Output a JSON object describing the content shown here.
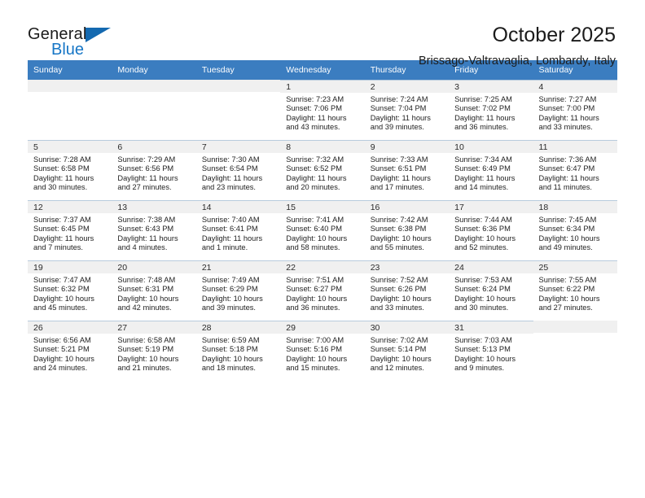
{
  "brand": {
    "name_part1": "General",
    "name_part2": "Blue",
    "triangle_color": "#1469b0",
    "blue_color": "#1676c6"
  },
  "header": {
    "title": "October 2025",
    "subtitle": "Brissago-Valtravaglia, Lombardy, Italy"
  },
  "calendar": {
    "header_bg": "#3b7dc0",
    "weekdays": [
      "Sunday",
      "Monday",
      "Tuesday",
      "Wednesday",
      "Thursday",
      "Friday",
      "Saturday"
    ],
    "weeks": [
      [
        {
          "day": "",
          "sunrise": "",
          "sunset": "",
          "daylight_line1": "",
          "daylight_line2": ""
        },
        {
          "day": "",
          "sunrise": "",
          "sunset": "",
          "daylight_line1": "",
          "daylight_line2": ""
        },
        {
          "day": "",
          "sunrise": "",
          "sunset": "",
          "daylight_line1": "",
          "daylight_line2": ""
        },
        {
          "day": "1",
          "sunrise": "Sunrise: 7:23 AM",
          "sunset": "Sunset: 7:06 PM",
          "daylight_line1": "Daylight: 11 hours",
          "daylight_line2": "and 43 minutes."
        },
        {
          "day": "2",
          "sunrise": "Sunrise: 7:24 AM",
          "sunset": "Sunset: 7:04 PM",
          "daylight_line1": "Daylight: 11 hours",
          "daylight_line2": "and 39 minutes."
        },
        {
          "day": "3",
          "sunrise": "Sunrise: 7:25 AM",
          "sunset": "Sunset: 7:02 PM",
          "daylight_line1": "Daylight: 11 hours",
          "daylight_line2": "and 36 minutes."
        },
        {
          "day": "4",
          "sunrise": "Sunrise: 7:27 AM",
          "sunset": "Sunset: 7:00 PM",
          "daylight_line1": "Daylight: 11 hours",
          "daylight_line2": "and 33 minutes."
        }
      ],
      [
        {
          "day": "5",
          "sunrise": "Sunrise: 7:28 AM",
          "sunset": "Sunset: 6:58 PM",
          "daylight_line1": "Daylight: 11 hours",
          "daylight_line2": "and 30 minutes."
        },
        {
          "day": "6",
          "sunrise": "Sunrise: 7:29 AM",
          "sunset": "Sunset: 6:56 PM",
          "daylight_line1": "Daylight: 11 hours",
          "daylight_line2": "and 27 minutes."
        },
        {
          "day": "7",
          "sunrise": "Sunrise: 7:30 AM",
          "sunset": "Sunset: 6:54 PM",
          "daylight_line1": "Daylight: 11 hours",
          "daylight_line2": "and 23 minutes."
        },
        {
          "day": "8",
          "sunrise": "Sunrise: 7:32 AM",
          "sunset": "Sunset: 6:52 PM",
          "daylight_line1": "Daylight: 11 hours",
          "daylight_line2": "and 20 minutes."
        },
        {
          "day": "9",
          "sunrise": "Sunrise: 7:33 AM",
          "sunset": "Sunset: 6:51 PM",
          "daylight_line1": "Daylight: 11 hours",
          "daylight_line2": "and 17 minutes."
        },
        {
          "day": "10",
          "sunrise": "Sunrise: 7:34 AM",
          "sunset": "Sunset: 6:49 PM",
          "daylight_line1": "Daylight: 11 hours",
          "daylight_line2": "and 14 minutes."
        },
        {
          "day": "11",
          "sunrise": "Sunrise: 7:36 AM",
          "sunset": "Sunset: 6:47 PM",
          "daylight_line1": "Daylight: 11 hours",
          "daylight_line2": "and 11 minutes."
        }
      ],
      [
        {
          "day": "12",
          "sunrise": "Sunrise: 7:37 AM",
          "sunset": "Sunset: 6:45 PM",
          "daylight_line1": "Daylight: 11 hours",
          "daylight_line2": "and 7 minutes."
        },
        {
          "day": "13",
          "sunrise": "Sunrise: 7:38 AM",
          "sunset": "Sunset: 6:43 PM",
          "daylight_line1": "Daylight: 11 hours",
          "daylight_line2": "and 4 minutes."
        },
        {
          "day": "14",
          "sunrise": "Sunrise: 7:40 AM",
          "sunset": "Sunset: 6:41 PM",
          "daylight_line1": "Daylight: 11 hours",
          "daylight_line2": "and 1 minute."
        },
        {
          "day": "15",
          "sunrise": "Sunrise: 7:41 AM",
          "sunset": "Sunset: 6:40 PM",
          "daylight_line1": "Daylight: 10 hours",
          "daylight_line2": "and 58 minutes."
        },
        {
          "day": "16",
          "sunrise": "Sunrise: 7:42 AM",
          "sunset": "Sunset: 6:38 PM",
          "daylight_line1": "Daylight: 10 hours",
          "daylight_line2": "and 55 minutes."
        },
        {
          "day": "17",
          "sunrise": "Sunrise: 7:44 AM",
          "sunset": "Sunset: 6:36 PM",
          "daylight_line1": "Daylight: 10 hours",
          "daylight_line2": "and 52 minutes."
        },
        {
          "day": "18",
          "sunrise": "Sunrise: 7:45 AM",
          "sunset": "Sunset: 6:34 PM",
          "daylight_line1": "Daylight: 10 hours",
          "daylight_line2": "and 49 minutes."
        }
      ],
      [
        {
          "day": "19",
          "sunrise": "Sunrise: 7:47 AM",
          "sunset": "Sunset: 6:32 PM",
          "daylight_line1": "Daylight: 10 hours",
          "daylight_line2": "and 45 minutes."
        },
        {
          "day": "20",
          "sunrise": "Sunrise: 7:48 AM",
          "sunset": "Sunset: 6:31 PM",
          "daylight_line1": "Daylight: 10 hours",
          "daylight_line2": "and 42 minutes."
        },
        {
          "day": "21",
          "sunrise": "Sunrise: 7:49 AM",
          "sunset": "Sunset: 6:29 PM",
          "daylight_line1": "Daylight: 10 hours",
          "daylight_line2": "and 39 minutes."
        },
        {
          "day": "22",
          "sunrise": "Sunrise: 7:51 AM",
          "sunset": "Sunset: 6:27 PM",
          "daylight_line1": "Daylight: 10 hours",
          "daylight_line2": "and 36 minutes."
        },
        {
          "day": "23",
          "sunrise": "Sunrise: 7:52 AM",
          "sunset": "Sunset: 6:26 PM",
          "daylight_line1": "Daylight: 10 hours",
          "daylight_line2": "and 33 minutes."
        },
        {
          "day": "24",
          "sunrise": "Sunrise: 7:53 AM",
          "sunset": "Sunset: 6:24 PM",
          "daylight_line1": "Daylight: 10 hours",
          "daylight_line2": "and 30 minutes."
        },
        {
          "day": "25",
          "sunrise": "Sunrise: 7:55 AM",
          "sunset": "Sunset: 6:22 PM",
          "daylight_line1": "Daylight: 10 hours",
          "daylight_line2": "and 27 minutes."
        }
      ],
      [
        {
          "day": "26",
          "sunrise": "Sunrise: 6:56 AM",
          "sunset": "Sunset: 5:21 PM",
          "daylight_line1": "Daylight: 10 hours",
          "daylight_line2": "and 24 minutes."
        },
        {
          "day": "27",
          "sunrise": "Sunrise: 6:58 AM",
          "sunset": "Sunset: 5:19 PM",
          "daylight_line1": "Daylight: 10 hours",
          "daylight_line2": "and 21 minutes."
        },
        {
          "day": "28",
          "sunrise": "Sunrise: 6:59 AM",
          "sunset": "Sunset: 5:18 PM",
          "daylight_line1": "Daylight: 10 hours",
          "daylight_line2": "and 18 minutes."
        },
        {
          "day": "29",
          "sunrise": "Sunrise: 7:00 AM",
          "sunset": "Sunset: 5:16 PM",
          "daylight_line1": "Daylight: 10 hours",
          "daylight_line2": "and 15 minutes."
        },
        {
          "day": "30",
          "sunrise": "Sunrise: 7:02 AM",
          "sunset": "Sunset: 5:14 PM",
          "daylight_line1": "Daylight: 10 hours",
          "daylight_line2": "and 12 minutes."
        },
        {
          "day": "31",
          "sunrise": "Sunrise: 7:03 AM",
          "sunset": "Sunset: 5:13 PM",
          "daylight_line1": "Daylight: 10 hours",
          "daylight_line2": "and 9 minutes."
        },
        {
          "day": "",
          "sunrise": "",
          "sunset": "",
          "daylight_line1": "",
          "daylight_line2": ""
        }
      ]
    ]
  }
}
